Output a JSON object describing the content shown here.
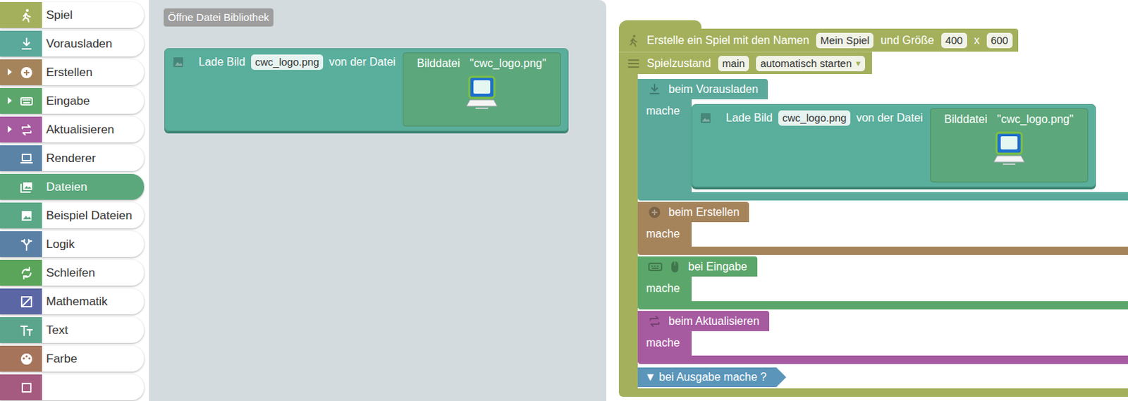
{
  "toolbox": {
    "items": [
      {
        "label": "Spiel",
        "selected": false,
        "expandable": false,
        "color": "#a5b05c"
      },
      {
        "label": "Vorausladen",
        "selected": false,
        "expandable": false,
        "color": "#5aa99b"
      },
      {
        "label": "Erstellen",
        "selected": false,
        "expandable": true,
        "color": "#a5845c"
      },
      {
        "label": "Eingabe",
        "selected": false,
        "expandable": true,
        "color": "#5ba66a"
      },
      {
        "label": "Aktualisieren",
        "selected": false,
        "expandable": true,
        "color": "#a65aa0"
      },
      {
        "label": "Renderer",
        "selected": false,
        "expandable": false,
        "color": "#5b83a6"
      },
      {
        "label": "Dateien",
        "selected": true,
        "expandable": false,
        "color": "#5ba87c"
      },
      {
        "label": "Beispiel Dateien",
        "selected": false,
        "expandable": false,
        "color": "#5ba887"
      },
      {
        "label": "Logik",
        "selected": false,
        "expandable": false,
        "color": "#5b80a5"
      },
      {
        "label": "Schleifen",
        "selected": false,
        "expandable": false,
        "color": "#5ba55b"
      },
      {
        "label": "Mathematik",
        "selected": false,
        "expandable": false,
        "color": "#5b67a5"
      },
      {
        "label": "Text",
        "selected": false,
        "expandable": false,
        "color": "#5ba58c"
      },
      {
        "label": "Farbe",
        "selected": false,
        "expandable": false,
        "color": "#a5745b"
      },
      {
        "label": "",
        "selected": false,
        "expandable": false,
        "color": "#a55b80"
      }
    ]
  },
  "flyout": {
    "button": "Öffne Datei Bibliothek",
    "block": {
      "label": "Lade Bild",
      "name": "cwc_logo.png",
      "suffix": "von der Datei",
      "file": {
        "label": "Bilddatei",
        "value": "\"cwc_logo.png\""
      }
    }
  },
  "workspace": {
    "game": {
      "label": "Erstelle ein Spiel mit den Namen",
      "name": "Mein Spiel",
      "size_label": "und Größe",
      "width": "400",
      "times": "x",
      "height": "600",
      "state": {
        "label": "Spielzustand",
        "name": "main",
        "mode": "automatisch starten",
        "arrow": "▾"
      },
      "sections": [
        {
          "label": "beim Vorausladen",
          "do": "mache",
          "color": "#5aa99b",
          "blocks": [
            {
              "label": "Lade Bild",
              "name": "cwc_logo.png",
              "suffix": "von der Datei",
              "file": {
                "label": "Bilddatei",
                "value": "\"cwc_logo.png\""
              }
            }
          ]
        },
        {
          "label": "beim Erstellen",
          "do": "mache",
          "color": "#a5845c",
          "blocks": []
        },
        {
          "label": "bei Eingabe",
          "do": "mache",
          "color": "#5ba66a",
          "blocks": []
        },
        {
          "label": "beim Aktualisieren",
          "do": "mache",
          "color": "#a65aa0",
          "blocks": []
        }
      ],
      "output": "▼ bei Ausgabe mache ?"
    }
  }
}
